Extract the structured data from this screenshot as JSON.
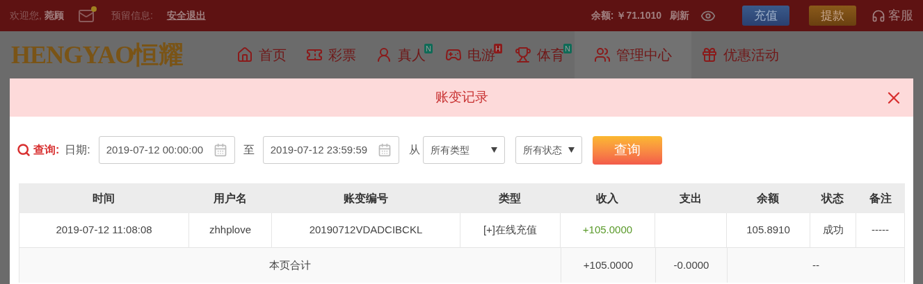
{
  "top_bar": {
    "welcome": "欢迎您,",
    "username": "菀顾",
    "mail_unread": true,
    "reserved_info_label": "预留信息:",
    "logout": "安全退出",
    "balance": "余额: ￥71.1010",
    "refresh": "刷新",
    "buttons": [
      {
        "label": "充值",
        "kind": "deposit"
      },
      {
        "label": "提款",
        "kind": "withdraw"
      }
    ],
    "support": "客服"
  },
  "nav": {
    "logo": "HENGYAO恒耀",
    "items": [
      {
        "label": "首页",
        "selected": false
      },
      {
        "label": "彩票",
        "selected": false
      },
      {
        "label": "真人",
        "selected": false,
        "badge": "N",
        "color": "#0f6b57"
      },
      {
        "label": "电游",
        "selected": false,
        "badge": "H",
        "color": "#8c1b1b"
      },
      {
        "label": "体育",
        "selected": false,
        "badge": "N",
        "color": "#0f6b57"
      },
      {
        "label": "管理中心",
        "selected": true
      },
      {
        "label": "优惠活动",
        "selected": false
      }
    ]
  },
  "dialog": {
    "title": "账变记录",
    "filter": {
      "query_label": "查询:",
      "date_label": "日期:",
      "date_from": "2019-07-12 00:00:00",
      "to_label": "至",
      "date_to": "2019-07-12 23:59:59",
      "from_label": "从",
      "type_select": "所有类型",
      "status_select": "所有状态",
      "submit": "查询"
    },
    "table": {
      "columns": [
        "时间",
        "用户名",
        "账变编号",
        "类型",
        "收入",
        "支出",
        "余额",
        "状态",
        "备注"
      ],
      "rows": [
        {
          "cells": [
            "2019-07-12 11:08:08",
            "zhhplove",
            "20190712VDADCIBCKL",
            "[+]在线充值",
            "+105.0000",
            "",
            "105.8910",
            "成功",
            "-----"
          ],
          "income_credited": true
        }
      ],
      "totals": {
        "label": "本页合计",
        "income": "+105.0000",
        "expense": "-0.0000",
        "rest": "--"
      }
    }
  }
}
